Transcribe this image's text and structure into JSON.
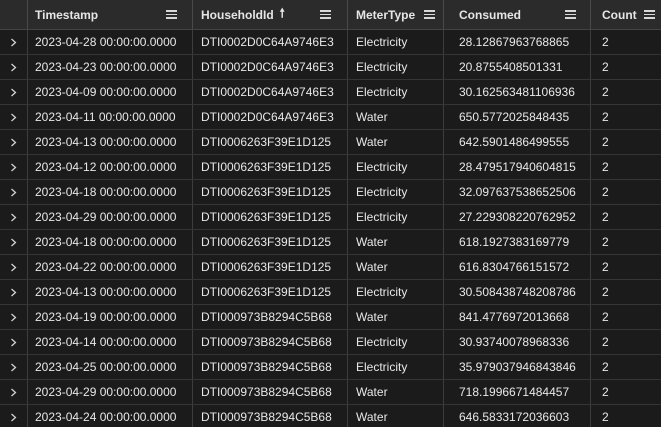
{
  "header": {
    "columns": [
      {
        "label": "Timestamp"
      },
      {
        "label": "HouseholdId",
        "sort": "ascending"
      },
      {
        "label": "MeterType"
      },
      {
        "label": "Consumed"
      },
      {
        "label": "Count"
      }
    ]
  },
  "icons": {
    "column_menu": "hamburger-menu-icon",
    "expand_row": "chevron-right-icon",
    "sort": "arrow-up-icon"
  },
  "colors": {
    "background": "#1b1b1b",
    "header_background": "#2b2b2b",
    "row_border": "#353535",
    "text": "#e8e8e8"
  },
  "rows": [
    {
      "timestamp": "2023-04-28 00:00:00.0000",
      "household": "DTI0002D0C64A9746E3",
      "meter": "Electricity",
      "consumed": "28.12867963768865",
      "count": "2"
    },
    {
      "timestamp": "2023-04-23 00:00:00.0000",
      "household": "DTI0002D0C64A9746E3",
      "meter": "Electricity",
      "consumed": "20.8755408501331",
      "count": "2"
    },
    {
      "timestamp": "2023-04-09 00:00:00.0000",
      "household": "DTI0002D0C64A9746E3",
      "meter": "Electricity",
      "consumed": "30.162563481106936",
      "count": "2"
    },
    {
      "timestamp": "2023-04-11 00:00:00.0000",
      "household": "DTI0002D0C64A9746E3",
      "meter": "Water",
      "consumed": "650.5772025848435",
      "count": "2"
    },
    {
      "timestamp": "2023-04-13 00:00:00.0000",
      "household": "DTI0006263F39E1D125",
      "meter": "Water",
      "consumed": "642.5901486499555",
      "count": "2"
    },
    {
      "timestamp": "2023-04-12 00:00:00.0000",
      "household": "DTI0006263F39E1D125",
      "meter": "Electricity",
      "consumed": "28.479517940604815",
      "count": "2"
    },
    {
      "timestamp": "2023-04-18 00:00:00.0000",
      "household": "DTI0006263F39E1D125",
      "meter": "Electricity",
      "consumed": "32.097637538652506",
      "count": "2"
    },
    {
      "timestamp": "2023-04-29 00:00:00.0000",
      "household": "DTI0006263F39E1D125",
      "meter": "Electricity",
      "consumed": "27.229308220762952",
      "count": "2"
    },
    {
      "timestamp": "2023-04-18 00:00:00.0000",
      "household": "DTI0006263F39E1D125",
      "meter": "Water",
      "consumed": "618.1927383169779",
      "count": "2"
    },
    {
      "timestamp": "2023-04-22 00:00:00.0000",
      "household": "DTI0006263F39E1D125",
      "meter": "Water",
      "consumed": "616.8304766151572",
      "count": "2"
    },
    {
      "timestamp": "2023-04-13 00:00:00.0000",
      "household": "DTI0006263F39E1D125",
      "meter": "Electricity",
      "consumed": "30.508438748208786",
      "count": "2"
    },
    {
      "timestamp": "2023-04-19 00:00:00.0000",
      "household": "DTI000973B8294C5B68",
      "meter": "Water",
      "consumed": "841.4776972013668",
      "count": "2"
    },
    {
      "timestamp": "2023-04-14 00:00:00.0000",
      "household": "DTI000973B8294C5B68",
      "meter": "Electricity",
      "consumed": "30.93740078968336",
      "count": "2"
    },
    {
      "timestamp": "2023-04-25 00:00:00.0000",
      "household": "DTI000973B8294C5B68",
      "meter": "Electricity",
      "consumed": "35.979037946843846",
      "count": "2"
    },
    {
      "timestamp": "2023-04-29 00:00:00.0000",
      "household": "DTI000973B8294C5B68",
      "meter": "Water",
      "consumed": "718.1996671484457",
      "count": "2"
    },
    {
      "timestamp": "2023-04-24 00:00:00.0000",
      "household": "DTI000973B8294C5B68",
      "meter": "Water",
      "consumed": "646.5833172036603",
      "count": "2"
    }
  ]
}
